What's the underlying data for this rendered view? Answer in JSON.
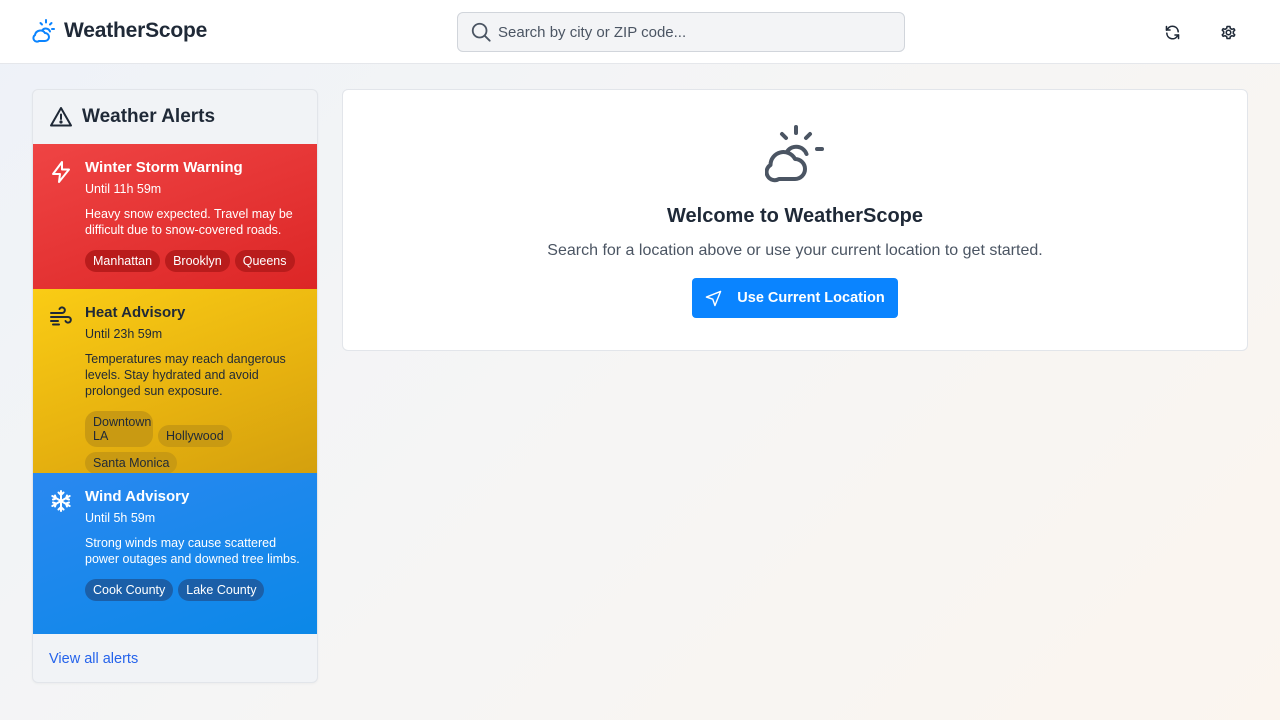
{
  "app": {
    "name": "WeatherScope",
    "accent_color": "#0a84ff"
  },
  "search": {
    "placeholder": "Search by city or ZIP code...",
    "value": ""
  },
  "alerts_panel": {
    "title": "Weather Alerts",
    "alerts": [
      {
        "title": "Winter Storm Warning",
        "until": "Until 11h 59m",
        "description": "Heavy snow expected. Travel may be difficult due to snow-covered roads.",
        "areas": [
          "Manhattan",
          "Brooklyn",
          "Queens"
        ],
        "icon": "lightning-icon",
        "color": "#ef4444"
      },
      {
        "title": "Heat Advisory",
        "until": "Until 23h 59m",
        "description": "Temperatures may reach dangerous levels. Stay hydrated and avoid prolonged sun exposure.",
        "areas": [
          "Downtown LA",
          "Hollywood",
          "Santa Monica"
        ],
        "icon": "wind-icon",
        "color": "#facc15"
      },
      {
        "title": "Wind Advisory",
        "until": "Until 5h 59m",
        "description": "Strong winds may cause scattered power outages and downed tree limbs.",
        "areas": [
          "Cook County",
          "Lake County"
        ],
        "icon": "snowflake-icon",
        "color": "#2a88f0"
      }
    ],
    "view_all_label": "View all alerts"
  },
  "welcome": {
    "title": "Welcome to WeatherScope",
    "subtitle": "Search for a location above or use your current location to get started.",
    "button_label": "Use Current Location",
    "icon": "sun-cloud-icon"
  },
  "header_actions": {
    "refresh_icon": "refresh-icon",
    "settings_icon": "gear-icon"
  }
}
